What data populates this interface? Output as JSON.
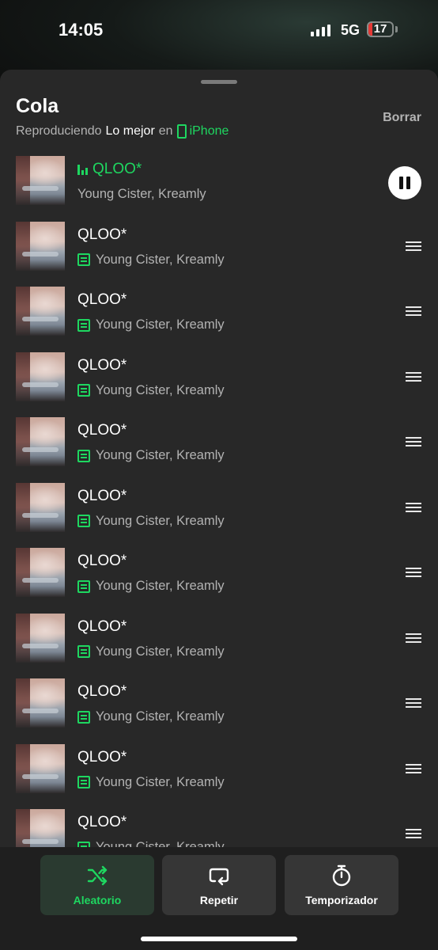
{
  "status_bar": {
    "time": "14:05",
    "network": "5G",
    "battery_level": "17",
    "signal_bars": 4
  },
  "header": {
    "title": "Cola",
    "subtitle_prefix": "Reproduciendo",
    "context_name": "Lo mejor",
    "subtitle_connector": "en",
    "device_name": "iPhone",
    "clear_label": "Borrar"
  },
  "now_playing": {
    "title": "QLOO*",
    "artist": "Young Cister, Kreamly",
    "state": "playing"
  },
  "queue": [
    {
      "title": "QLOO*",
      "artist": "Young Cister, Kreamly"
    },
    {
      "title": "QLOO*",
      "artist": "Young Cister, Kreamly"
    },
    {
      "title": "QLOO*",
      "artist": "Young Cister, Kreamly"
    },
    {
      "title": "QLOO*",
      "artist": "Young Cister, Kreamly"
    },
    {
      "title": "QLOO*",
      "artist": "Young Cister, Kreamly"
    },
    {
      "title": "QLOO*",
      "artist": "Young Cister, Kreamly"
    },
    {
      "title": "QLOO*",
      "artist": "Young Cister, Kreamly"
    },
    {
      "title": "QLOO*",
      "artist": "Young Cister, Kreamly"
    },
    {
      "title": "QLOO*",
      "artist": "Young Cister, Kreamly"
    },
    {
      "title": "QLOO*",
      "artist": "Young Cister, Kreamly"
    }
  ],
  "controls": [
    {
      "label": "Aleatorio",
      "icon": "shuffle-icon",
      "active": true
    },
    {
      "label": "Repetir",
      "icon": "repeat-icon",
      "active": false
    },
    {
      "label": "Temporizador",
      "icon": "timer-icon",
      "active": false
    }
  ],
  "colors": {
    "accent": "#1ed760",
    "sheet": "#282828",
    "secondary_text": "#b3b3b3"
  }
}
